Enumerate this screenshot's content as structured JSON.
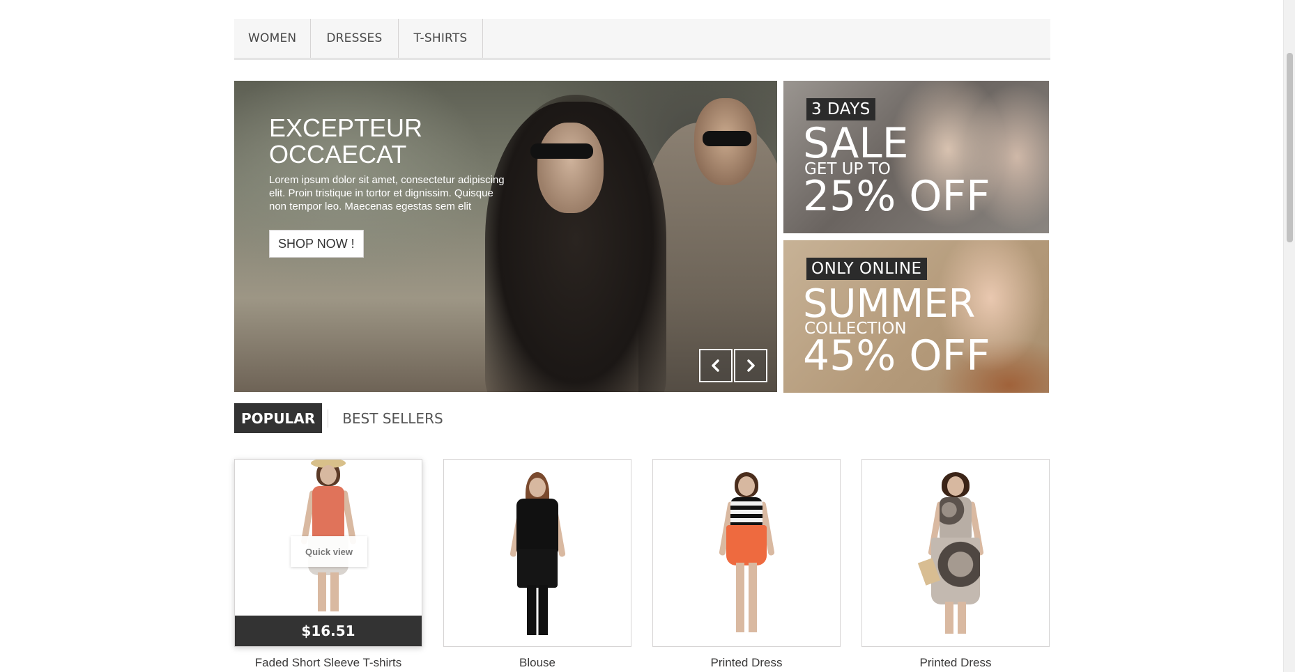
{
  "nav": {
    "items": [
      {
        "label": "WOMEN"
      },
      {
        "label": "DRESSES"
      },
      {
        "label": "T-SHIRTS"
      }
    ]
  },
  "hero": {
    "title_line1": "EXCEPTEUR",
    "title_line2": "OCCAECAT",
    "text": "Lorem ipsum dolor sit amet, consectetur adipiscing elit. Proin tristique in tortor et dignissim. Quisque non tempor leo. Maecenas egestas sem elit",
    "button_label": "SHOP NOW !",
    "prev_icon": "chevron-left-icon",
    "next_icon": "chevron-right-icon"
  },
  "promos": [
    {
      "tag": "3 DAYS",
      "big": "SALE",
      "small": "GET UP TO",
      "offer": "25% OFF"
    },
    {
      "tag": "ONLY ONLINE",
      "big": "SUMMER",
      "small": "COLLECTION",
      "offer": "45% OFF"
    }
  ],
  "tabs": [
    {
      "label": "POPULAR",
      "active": true
    },
    {
      "label": "BEST SELLERS",
      "active": false
    }
  ],
  "products": [
    {
      "name": "Faded Short Sleeve T-shirts",
      "price": "$16.51",
      "quick_view": "Quick view"
    },
    {
      "name": "Blouse"
    },
    {
      "name": "Printed Dress"
    },
    {
      "name": "Printed Dress"
    }
  ],
  "colors": {
    "dark": "#333333",
    "nav_bg": "#f6f6f6",
    "border": "#d6d4d4"
  }
}
